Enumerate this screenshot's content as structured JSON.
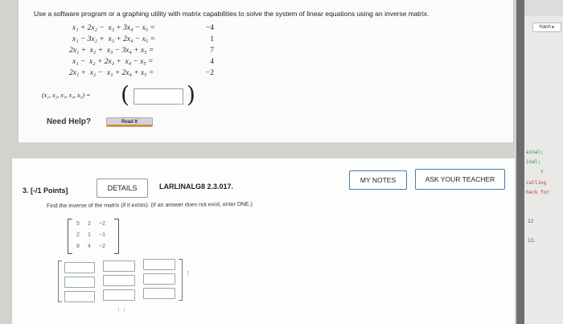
{
  "problem2": {
    "instruction": "Use a software program or a graphing utility with matrix capabilities to solve the system of linear equations using an inverse matrix.",
    "equations": [
      {
        "lhs": "x₁ + 2x₂ −  x₃ + 3x₄ − x₅ =",
        "rhs": "−4"
      },
      {
        "lhs": "x₁ − 3x₂ +  x₃ + 2x₄ − x₅ =",
        "rhs": "1"
      },
      {
        "lhs": "2x₁ +  x₂ +  x₃ − 3x₄ + x₅ =",
        "rhs": "7"
      },
      {
        "lhs": "x₁ −  x₂ + 2x₃ +  x₄ − x₅ =",
        "rhs": "4"
      },
      {
        "lhs": "2x₁ +  x₂ −  x₃ + 2x₄ + x₅ =",
        "rhs": "−2"
      }
    ],
    "answer_label": "(x₁, x₂, x₃, x₄, x₅) =",
    "answer_value": "",
    "need_help": "Need Help?",
    "read_it": "Read It"
  },
  "problem3": {
    "label": "3. [-/1 Points]",
    "details_button": "DETAILS",
    "code": "LARLINALG8 2.3.017.",
    "my_notes_button": "MY NOTES",
    "ask_teacher_button": "ASK YOUR TEACHER",
    "instruction": "Find the inverse of the matrix (if it exists). (If an answer does not exist, enter DNE.)",
    "matrix": [
      [
        "5",
        "2",
        "−2"
      ],
      [
        "2",
        "1",
        "−1"
      ],
      [
        "8",
        "4",
        "−2"
      ]
    ],
    "answer_cells": [
      "",
      "",
      "",
      "",
      "",
      "",
      "",
      "",
      ""
    ]
  },
  "sidebar": {
    "hanh_button": "Hanh ▸",
    "fragments": [
      "",
      "ainal;",
      "inal;",
      "r",
      "calling",
      "heck for",
      "12",
      "13."
    ]
  },
  "colors": {
    "accent_orange": "#e08a1e",
    "button_border": "#4a7ab0"
  }
}
